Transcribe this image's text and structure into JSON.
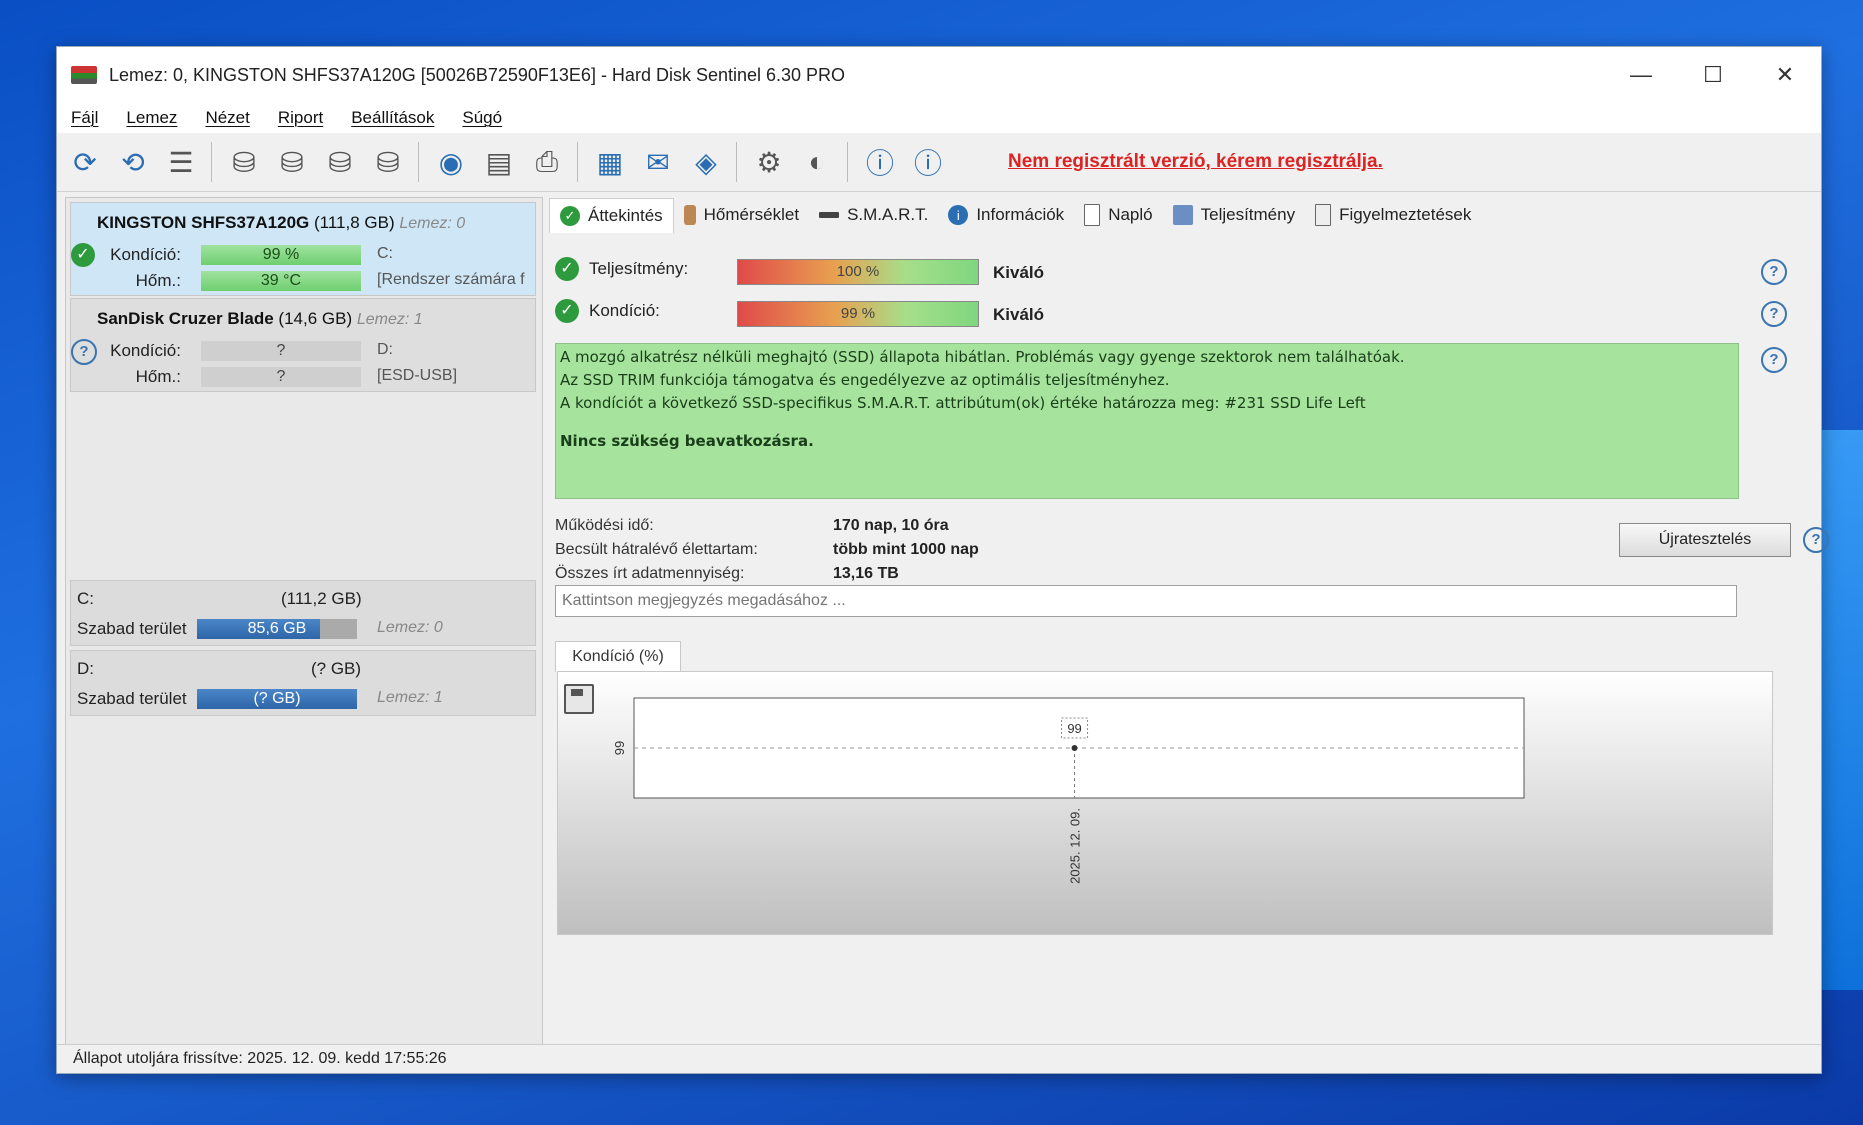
{
  "window": {
    "title": "Lemez: 0, KINGSTON SHFS37A120G [50026B72590F13E6]  -  Hard Disk Sentinel 6.30 PRO",
    "minimize": "—",
    "maximize": "☐",
    "close": "✕"
  },
  "menu": [
    "Fájl",
    "Lemez",
    "Nézet",
    "Riport",
    "Beállítások",
    "Súgó"
  ],
  "toolbar": {
    "unregistered": "Nem regisztrált verzió, kérem regisztrálja."
  },
  "disks": [
    {
      "name": "KINGSTON SHFS37A120G",
      "size": "(111,8 GB)",
      "lemez": "Lemez: 0",
      "kondicio_label": "Kondíció:",
      "kondicio_value": "99 %",
      "kondicio_extra": "C:",
      "hom_label": "Hőm.:",
      "hom_value": "39 °C",
      "hom_extra": "[Rendszer számára f"
    },
    {
      "name": "SanDisk Cruzer Blade",
      "size": "(14,6 GB)",
      "lemez": "Lemez: 1",
      "kondicio_label": "Kondíció:",
      "kondicio_value": "?",
      "kondicio_extra": "D:",
      "hom_label": "Hőm.:",
      "hom_value": "?",
      "hom_extra": "[ESD-USB]"
    }
  ],
  "volumes": [
    {
      "drive": "C:",
      "size": "(111,2 GB)",
      "free_label": "Szabad terület",
      "free_value": "85,6 GB",
      "free_fraction": 0.77,
      "lemez": "Lemez: 0"
    },
    {
      "drive": "D:",
      "size": "(? GB)",
      "free_label": "Szabad terület",
      "free_value": "(? GB)",
      "free_fraction": 1.0,
      "lemez": "Lemez: 1"
    }
  ],
  "status": "Állapot utoljára frissítve: 2025. 12. 09. kedd 17:55:26",
  "tabs": [
    "Áttekintés",
    "Hőmérséklet",
    "S.M.A.R.T.",
    "Információk",
    "Napló",
    "Teljesítmény",
    "Figyelmeztetések"
  ],
  "overview": {
    "perf_label": "Teljesítmény:",
    "perf_value": "100 %",
    "perf_fraction": 1.0,
    "perf_rating": "Kiváló",
    "cond_label": "Kondíció:",
    "cond_value": "99 %",
    "cond_fraction": 0.99,
    "cond_rating": "Kiváló",
    "messages": [
      "A mozgó alkatrész nélküli meghajtó (SSD) állapota hibátlan. Problémás vagy gyenge szektorok nem találhatóak.",
      "Az SSD TRIM funkciója támogatva és engedélyezve az optimális teljesítményhez.",
      "A kondíciót a következő SSD-specifikus S.M.A.R.T. attribútum(ok) értéke határozza meg:  #231 SSD Life Left"
    ],
    "action": "Nincs szükség beavatkozásra.",
    "uptime_label": "Működési idő:",
    "uptime_value": "170 nap, 10 óra",
    "life_label": "Becsült hátralévő élettartam:",
    "life_value": "több mint 1000 nap",
    "written_label": "Összes írt adatmennyiség:",
    "written_value": "13,16 TB",
    "retest_label": "Újratesztelés",
    "note_placeholder": "Kattintson megjegyzés megadásához ..."
  },
  "chart_data": {
    "type": "line",
    "title": "Kondíció  (%)",
    "x": [
      "2025. 12. 09."
    ],
    "series": [
      {
        "values": [
          99
        ]
      }
    ],
    "yticks": [
      "99"
    ],
    "point_label": "99",
    "ylim": [
      98,
      100
    ]
  }
}
